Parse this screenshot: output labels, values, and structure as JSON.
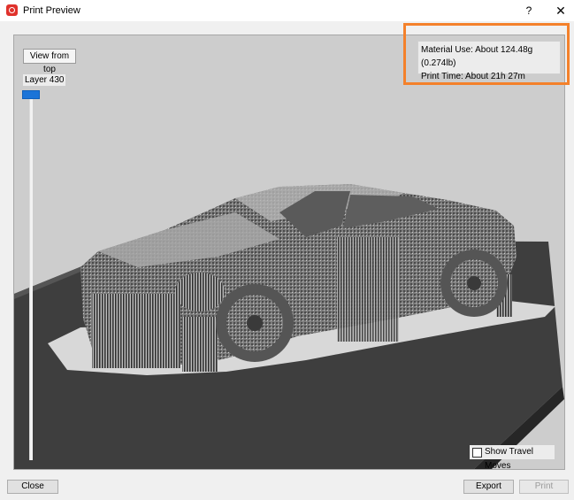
{
  "window": {
    "title": "Print Preview",
    "help_label": "?",
    "close_label": "✕"
  },
  "viewport": {
    "view_top_label": "View from top",
    "layer_label": "Layer 430",
    "info": {
      "material_use": "Material Use: About 124.48g (0.274lb)",
      "print_time": "Print Time: About 21h 27m"
    },
    "show_travel_moves_label": "Show Travel Moves",
    "show_travel_moves_checked": false
  },
  "footer": {
    "close_label": "Close",
    "export_label": "Export",
    "print_label": "Print"
  },
  "colors": {
    "accent": "#1b74d8",
    "highlight": "#f4812b",
    "bed": "#3e3e3e"
  }
}
